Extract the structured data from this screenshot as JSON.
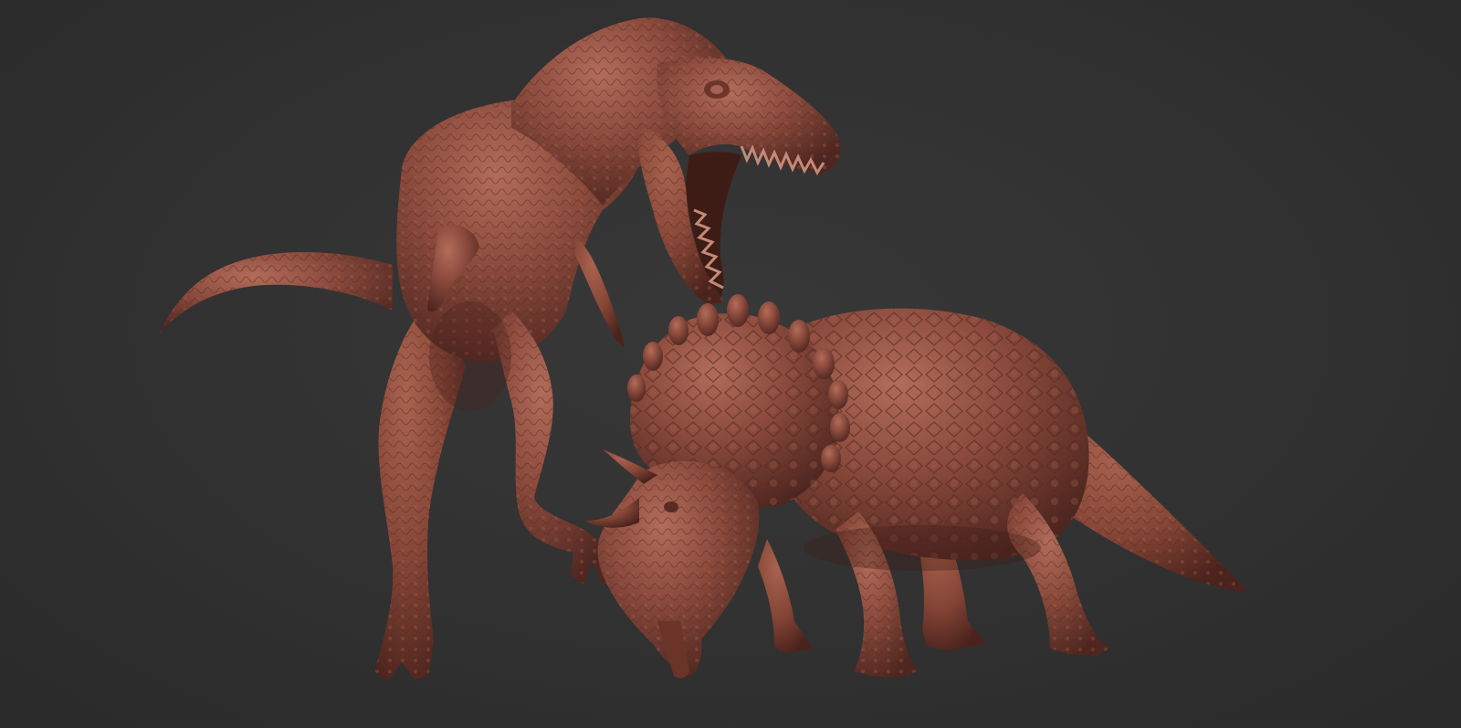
{
  "scene": {
    "background_color": "#2f2f2f",
    "clay_color": "#8a4a3c",
    "clay_highlight": "#b06a58",
    "clay_shadow": "#4e2620",
    "subjects": [
      {
        "name": "tyrannosaurus-sculpt"
      },
      {
        "name": "triceratops-sculpt"
      }
    ]
  }
}
